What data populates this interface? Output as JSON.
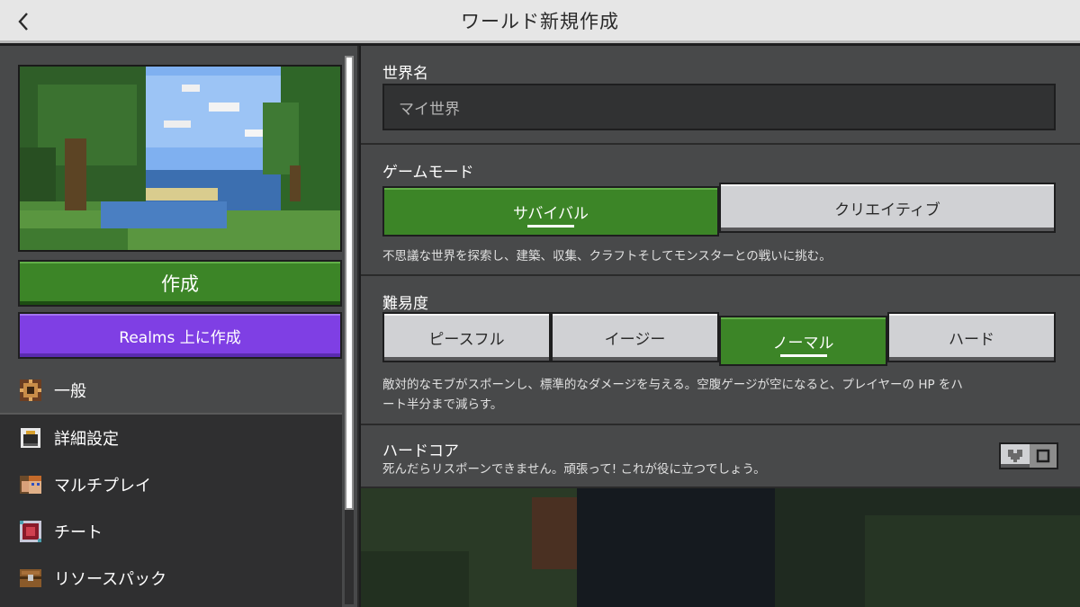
{
  "header": {
    "title": "ワールド新規作成",
    "back_icon": "chevron-left-icon"
  },
  "left": {
    "create_label": "作成",
    "realms_label": "Realms 上に作成",
    "nav": [
      {
        "label": "一般",
        "icon": "gear-icon",
        "active": true
      },
      {
        "label": "詳細設定",
        "icon": "advanced-settings-icon",
        "active": false
      },
      {
        "label": "マルチプレイ",
        "icon": "multiplayer-icon",
        "active": false
      },
      {
        "label": "チート",
        "icon": "cheats-icon",
        "active": false
      },
      {
        "label": "リソースパック",
        "icon": "resource-pack-icon",
        "active": false
      }
    ]
  },
  "world_name": {
    "label": "世界名",
    "value": "マイ世界"
  },
  "game_mode": {
    "label": "ゲームモード",
    "options": [
      "サバイバル",
      "クリエイティブ"
    ],
    "selected": "サバイバル",
    "description": "不思議な世界を探索し、建築、収集、クラフトそしてモンスターとの戦いに挑む。"
  },
  "difficulty": {
    "label": "難易度",
    "options": [
      "ピースフル",
      "イージー",
      "ノーマル",
      "ハード"
    ],
    "selected": "ノーマル",
    "description_line1": "敵対的なモブがスポーンし、標準的なダメージを与える。空腹ゲージが空になると、プレイヤーの HP をハ",
    "description_line2": "ート半分まで減らす。"
  },
  "hardcore": {
    "label": "ハードコア",
    "description": "死んだらリスポーンできません。頑張って! これが役に立つでしょう。",
    "enabled": false
  },
  "colors": {
    "accent_green": "#3c8527",
    "realms_purple": "#7f3fe4",
    "panel": "#48494a"
  }
}
